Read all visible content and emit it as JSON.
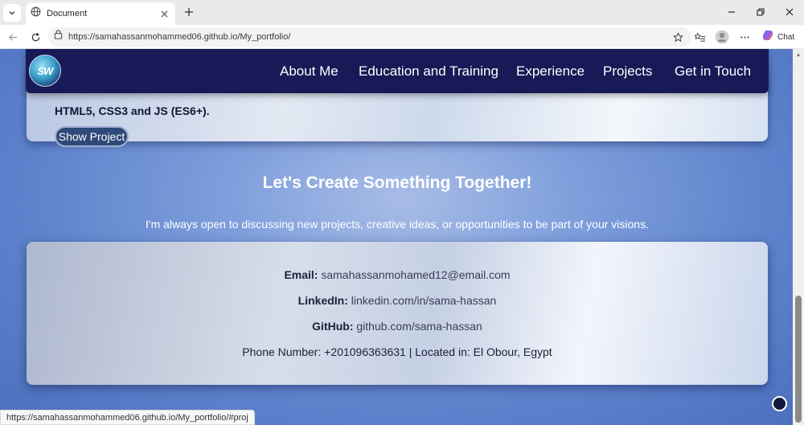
{
  "browser": {
    "tab_title": "Document",
    "url": "https://samahassanmohammed06.github.io/My_portfolio/",
    "chat_label": "Chat",
    "status_url": "https://samahassanmohammed06.github.io/My_portfolio/#proj"
  },
  "navbar": {
    "logo_text": "SW",
    "links": [
      "About Me",
      "Education and Training",
      "Experience",
      "Projects",
      "Get in Touch"
    ]
  },
  "project": {
    "tech_text": "HTML5, CSS3 and JS (ES6+).",
    "button_label": "Show Project"
  },
  "contact": {
    "title": "Let's Create Something Together!",
    "subtitle": "I'm always open to discussing new projects, creative ideas, or opportunities to be part of your visions.",
    "email_label": "Email:",
    "email_value": "samahassanmohamed12@email.com",
    "linkedin_label": "LinkedIn:",
    "linkedin_value": "linkedin.com/in/sama-hassan",
    "github_label": "GitHub:",
    "github_value": "github.com/sama-hassan",
    "phone_line": "Phone Number: +201096363631 | Located in: El Obour, Egypt"
  }
}
